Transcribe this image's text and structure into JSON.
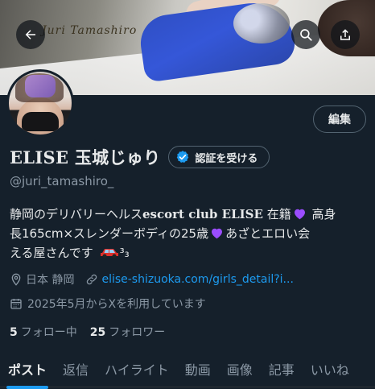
{
  "banner": {
    "script_text": "Juri Tamashiro"
  },
  "header": {
    "back_icon": "arrow-left-icon",
    "search_icon": "search-icon",
    "share_icon": "share-icon"
  },
  "profile": {
    "name": "ELISE 玉城じゅり",
    "handle": "@juri_tamashiro_",
    "edit_label": "編集",
    "verify_label": "認証を受ける",
    "bio": {
      "line1_a": "静岡のデリバリーヘルス",
      "line1_b": "escort club ELISE",
      "line1_c": "在籍",
      "line1_d": "高身",
      "line2_a": "長165cm×スレンダーボディの25歳",
      "line2_b": "あざとエロい会",
      "line3_a": "える屋さんです",
      "line3_b": "³₃"
    },
    "location": "日本 静岡",
    "website": "elise-shizuoka.com/girls_detail?i...",
    "joined": "2025年5月からXを利用しています",
    "following_count": "5",
    "following_label": "フォロー中",
    "followers_count": "25",
    "followers_label": "フォロワー"
  },
  "tabs": [
    "ポスト",
    "返信",
    "ハイライト",
    "動画",
    "画像",
    "記事",
    "いいね"
  ],
  "colors": {
    "background": "#15202b",
    "accent": "#1d9bf0",
    "muted": "#8b98a5",
    "heart": "#9b4dff"
  }
}
